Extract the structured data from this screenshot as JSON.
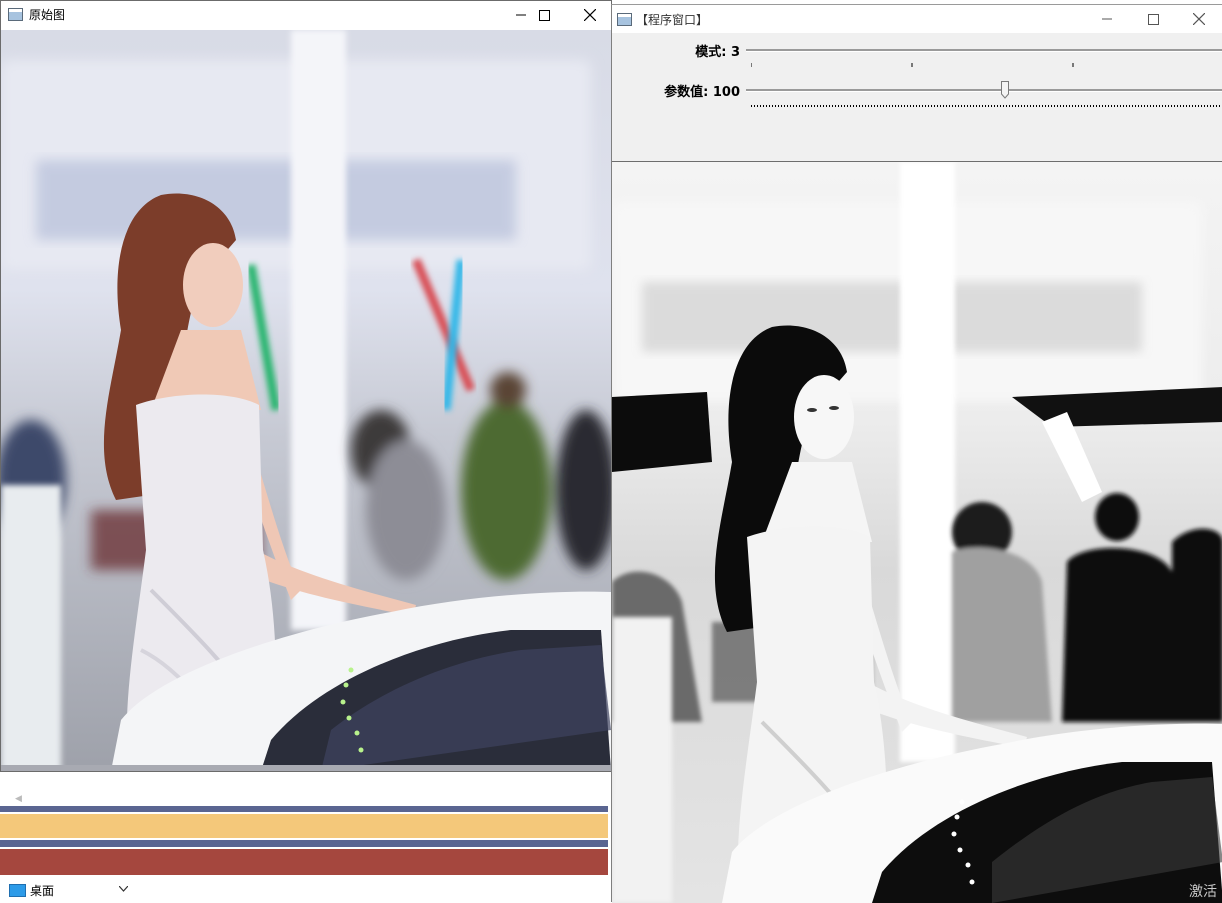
{
  "left_window": {
    "title": "原始图",
    "icon": "opencv-window-icon",
    "controls": [
      "minimize",
      "maximize",
      "close"
    ],
    "image": "color-photo-woman-white-dress-car-show"
  },
  "right_window": {
    "title": "【程序窗口】",
    "icon": "opencv-window-icon",
    "controls": [
      "minimize",
      "maximize",
      "close"
    ],
    "trackbars": [
      {
        "label": "模式: 3",
        "value": 3,
        "max": 3,
        "position": 1.0
      },
      {
        "label": "参数值: 100",
        "value": 100,
        "position": 0.53
      }
    ],
    "image": "grayscale-processed-photo"
  },
  "desktop": {
    "folder_label": "桌面",
    "folder_icon": "folder-icon",
    "bands": [
      "#5a6591",
      "#f4c87a",
      "#5a6591",
      "#a5473e"
    ],
    "corner_text": "激活"
  },
  "colors": {
    "window_bg": "#f0f0f0",
    "track": "#9a9a9a"
  }
}
